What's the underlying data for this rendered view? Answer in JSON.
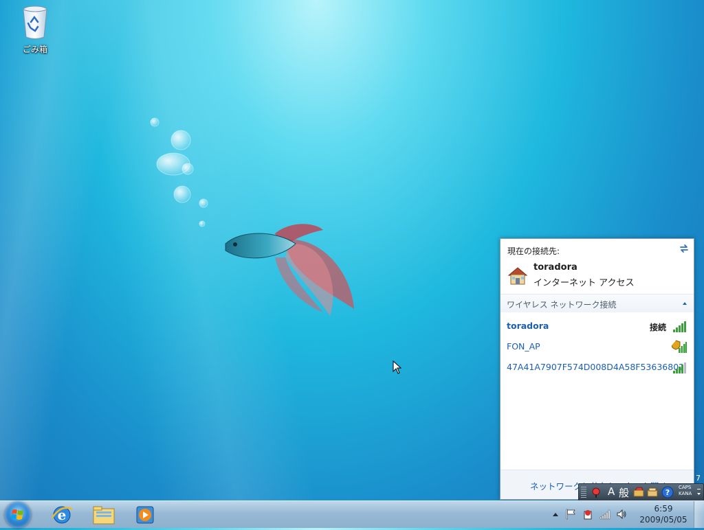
{
  "desktop": {
    "icons": [
      {
        "label": "ごみ箱",
        "icon": "recycle-bin-icon"
      }
    ]
  },
  "network_popup": {
    "header": "現在の接続先:",
    "current": {
      "name": "toradora",
      "status": "インターネット アクセス"
    },
    "section_label": "ワイヤレス ネットワーク接続",
    "networks": [
      {
        "name": "toradora",
        "state": "接続",
        "secured": false,
        "active": true,
        "signal": 5
      },
      {
        "name": "FON_AP",
        "state": "",
        "secured": true,
        "active": false,
        "signal": 5
      },
      {
        "name": "47A41A7907F574D008D4A58F53636802",
        "state": "",
        "secured": false,
        "active": false,
        "signal": 4
      }
    ],
    "footer_link": "ネットワークと共有センターを開く"
  },
  "language_bar": {
    "input_mode": "A",
    "mode_label": "般",
    "caps": "CAPS",
    "kana": "KANA",
    "badge": "7"
  },
  "taskbar": {
    "pinned": [
      "internet-explorer-icon",
      "windows-explorer-icon",
      "media-player-icon"
    ],
    "clock": {
      "time": "6:59",
      "date": "2009/05/05"
    }
  },
  "colors": {
    "link": "#1a5fb4",
    "signal": "#3aa13a",
    "taskbar": "#98b9d6"
  }
}
